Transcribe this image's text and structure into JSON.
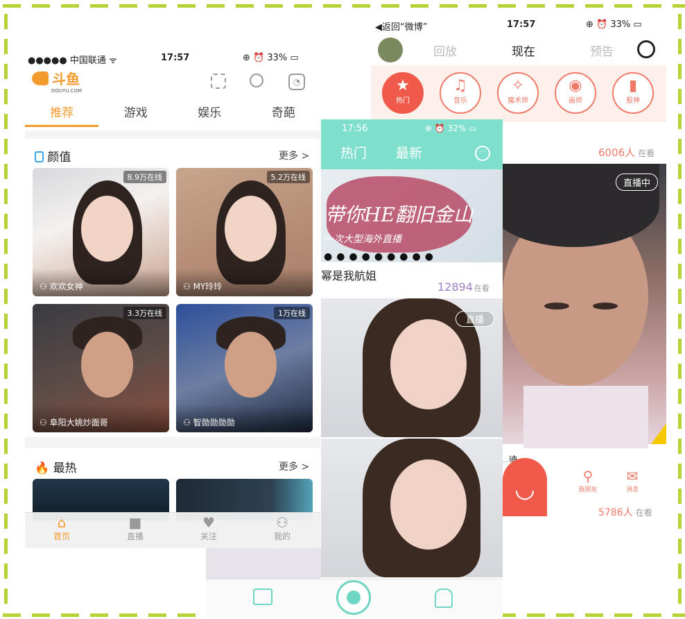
{
  "douyu": {
    "status": {
      "carrier": "●●●●● 中国联通 ᯤ",
      "time": "17:57",
      "battery": "33%"
    },
    "logo": "斗鱼",
    "logo_sub": "DOUYU.COM",
    "tabs": [
      "推荐",
      "游戏",
      "娱乐",
      "奇葩"
    ],
    "section1": {
      "title": "颜值",
      "more": "更多 >"
    },
    "cards": [
      {
        "online": "8.9万在线",
        "name": "欢欢女神"
      },
      {
        "online": "5.2万在线",
        "name": "MY玲玲"
      },
      {
        "online": "3.3万在线",
        "name": "阜阳大姚炒面哥"
      },
      {
        "online": "1万在线",
        "name": "智勋勋勋勋"
      }
    ],
    "section2": {
      "title": "最热",
      "more": "更多 >"
    },
    "bottom_nav": [
      "首页",
      "直播",
      "关注",
      "我的"
    ]
  },
  "weibo_live": {
    "status": {
      "back": "◀返回“微博”",
      "time": "17:57",
      "battery": "33%"
    },
    "tabs": [
      "回放",
      "现在",
      "预告"
    ],
    "categories": [
      "热门",
      "音乐",
      "魔术师",
      "画师",
      "股神"
    ],
    "viewers": "6006人",
    "viewers_suffix": "在看",
    "live_badge": "直播中",
    "bottom_items": [
      "我朋友",
      "消息"
    ],
    "viewers2": "5786人",
    "viewers2_suffix": "在看",
    "partial_name": "...迪"
  },
  "miaopai": {
    "status": {
      "time": "17:56",
      "battery": "32%"
    },
    "tabs": [
      "热门",
      "最新"
    ],
    "banner_text": "带你HE翻旧金山",
    "banner_sub": "一次大型海外直播",
    "stream_title": "幂是我航姐",
    "viewers": "12894",
    "viewers_suffix": "在看",
    "live_badge": "直播"
  },
  "colors": {
    "douyu_orange": "#f39a2c",
    "teal": "#6fd6c3",
    "coral": "#f07a6a",
    "frame_green": "#b5d334"
  }
}
